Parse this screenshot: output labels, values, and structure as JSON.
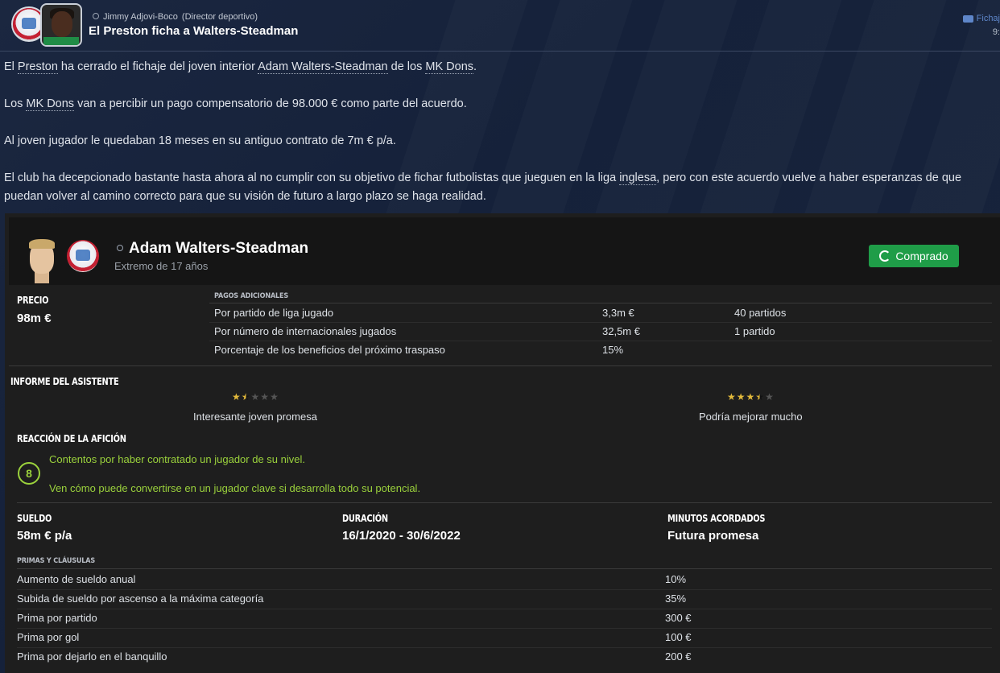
{
  "header": {
    "author": "Jimmy Adjovi-Boco",
    "author_role": "(Director deportivo)",
    "title": "El Preston ficha a Walters-Steadman",
    "tag_label": "Fichaj",
    "time": "9:"
  },
  "article": {
    "p1": {
      "t1": "El ",
      "club_link": "Preston",
      "t2": " ha cerrado el fichaje del joven interior ",
      "player_link": "Adam Walters-Steadman",
      "t3": " de los ",
      "from_link": "MK Dons",
      "t4": "."
    },
    "p2": {
      "t1": "Los ",
      "from_link": "MK Dons",
      "t2": " van a percibir un pago compensatorio de 98.000 € como parte del acuerdo."
    },
    "p3": "Al joven jugador le quedaban 18 meses en su antiguo contrato de 7m € p/a.",
    "p4": {
      "t1": "El club ha decepcionado bastante hasta ahora al no cumplir con su objetivo de fichar futbolistas que jueguen en la liga ",
      "league_link": "inglesa",
      "t2": ", pero con este acuerdo vuelve a haber esperanzas de que puedan volver al camino correcto para que su visión de futuro a largo plazo se haga realidad."
    }
  },
  "player": {
    "name": "Adam Walters-Steadman",
    "subtitle": "Extremo de 17 años",
    "status_button": "Comprado"
  },
  "price": {
    "label": "PRECIO",
    "value": "98m €"
  },
  "additional_payments": {
    "label": "PAGOS ADICIONALES",
    "rows": [
      {
        "desc": "Por partido de liga jugado",
        "amount": "3,3m €",
        "condition": "40 partidos"
      },
      {
        "desc": "Por número de internacionales jugados",
        "amount": "32,5m €",
        "condition": "1 partido"
      },
      {
        "desc": "Porcentaje de los beneficios del próximo traspaso",
        "amount": "15%",
        "condition": ""
      }
    ]
  },
  "assistant_report": {
    "label": "INFORME DEL ASISTENTE",
    "current": {
      "stars": 1.5,
      "max": 5,
      "text": "Interesante joven promesa"
    },
    "potential": {
      "stars": 3.5,
      "max": 5,
      "text": "Podría mejorar mucho"
    }
  },
  "fan_reaction": {
    "label": "REACCIÓN DE LA AFICIÓN",
    "score": "8",
    "line1": "Contentos por haber contratado un jugador de su nivel.",
    "line2": "Ven cómo puede convertirse en un jugador clave si desarrolla todo su potencial."
  },
  "contract": {
    "wage_label": "SUELDO",
    "wage_value": "58m € p/a",
    "duration_label": "DURACIÓN",
    "duration_value": "16/1/2020 - 30/6/2022",
    "minutes_label": "MINUTOS ACORDADOS",
    "minutes_value": "Futura promesa"
  },
  "bonuses": {
    "label": "PRIMAS Y CLÁUSULAS",
    "rows": [
      {
        "desc": "Aumento de sueldo anual",
        "value": "10%"
      },
      {
        "desc": "Subida de sueldo por ascenso a la máxima categoría",
        "value": "35%"
      },
      {
        "desc": "Prima por partido",
        "value": "300 €"
      },
      {
        "desc": "Prima por gol",
        "value": "100 €"
      },
      {
        "desc": "Prima por dejarlo en el banquillo",
        "value": "200 €"
      }
    ]
  },
  "colors": {
    "accent_green": "#1f9d48",
    "fan_green": "#9bd23c",
    "star_gold": "#e2b93b",
    "link_blue": "#5e86c9"
  }
}
